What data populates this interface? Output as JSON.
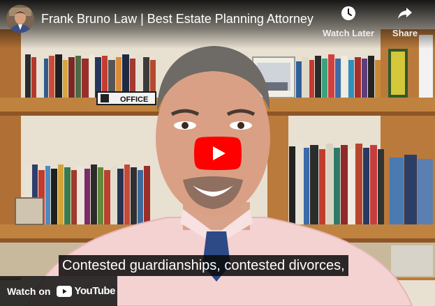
{
  "player": {
    "title": "Frank Bruno Law | Best Estate Planning Attorney",
    "actions": {
      "watch_later_label": "Watch Later",
      "share_label": "Share"
    },
    "caption": "Contested guardianships, contested divorces,",
    "branding": {
      "watch_on_label": "Watch on",
      "youtube_label": "YouTube"
    },
    "scene_text": {
      "office_sign": "OFFICE"
    },
    "colors": {
      "play_button": "#ff0000",
      "shelf_wood": "#b7773a",
      "wall": "#e9e2d4",
      "shirt": "#f3cfcf",
      "tie": "#2e4a86"
    },
    "icons": {
      "watch_later": "clock-icon",
      "share": "share-arrow-icon",
      "play": "play-icon",
      "youtube": "youtube-logo-icon"
    }
  }
}
